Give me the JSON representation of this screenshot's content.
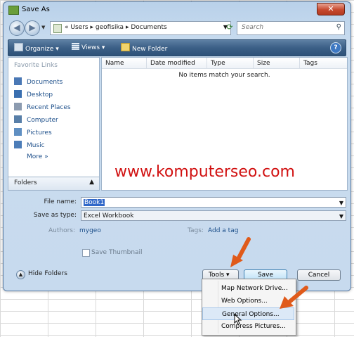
{
  "window": {
    "title": "Save As"
  },
  "nav": {
    "path_prefix": "«",
    "path": [
      "Users",
      "geofisika",
      "Documents"
    ],
    "path_separator": "▸",
    "search_placeholder": "Search"
  },
  "toolbar": {
    "organize": "Organize",
    "views": "Views",
    "new_folder": "New Folder"
  },
  "sidebar": {
    "favorite_links_title": "Favorite Links",
    "items": [
      {
        "label": "Documents",
        "icon": "documents-icon",
        "color": "#4a78b5"
      },
      {
        "label": "Desktop",
        "icon": "desktop-icon",
        "color": "#3a6fb0"
      },
      {
        "label": "Recent Places",
        "icon": "recent-places-icon",
        "color": "#8c9bb0"
      },
      {
        "label": "Computer",
        "icon": "computer-icon",
        "color": "#587fa8"
      },
      {
        "label": "Pictures",
        "icon": "pictures-icon",
        "color": "#5f8fc2"
      },
      {
        "label": "Music",
        "icon": "music-icon",
        "color": "#4c7db8"
      },
      {
        "label": "More »",
        "icon": "",
        "color": ""
      }
    ],
    "folders_label": "Folders"
  },
  "file_list": {
    "columns": [
      "Name",
      "Date modified",
      "Type",
      "Size",
      "Tags"
    ],
    "empty_message": "No items match your search."
  },
  "watermark": "www.komputerseo.com",
  "form": {
    "file_name_label": "File name:",
    "file_name_value": "Book1",
    "save_type_label": "Save as type:",
    "save_type_value": "Excel Workbook",
    "authors_label": "Authors:",
    "authors_value": "mygeo",
    "tags_label": "Tags:",
    "tags_value": "Add a tag",
    "thumbnail_label": "Save Thumbnail",
    "thumbnail_checked": false
  },
  "footer": {
    "hide_folders": "Hide Folders",
    "tools": "Tools",
    "save": "Save",
    "cancel": "Cancel"
  },
  "tools_menu": {
    "items": [
      "Map Network Drive...",
      "Web Options...",
      "General Options...",
      "Compress Pictures..."
    ],
    "highlighted": "General Options..."
  },
  "colors": {
    "accent_arrow": "#e05a1a",
    "watermark": "#d11111",
    "toolbar": "#3b5f86"
  }
}
